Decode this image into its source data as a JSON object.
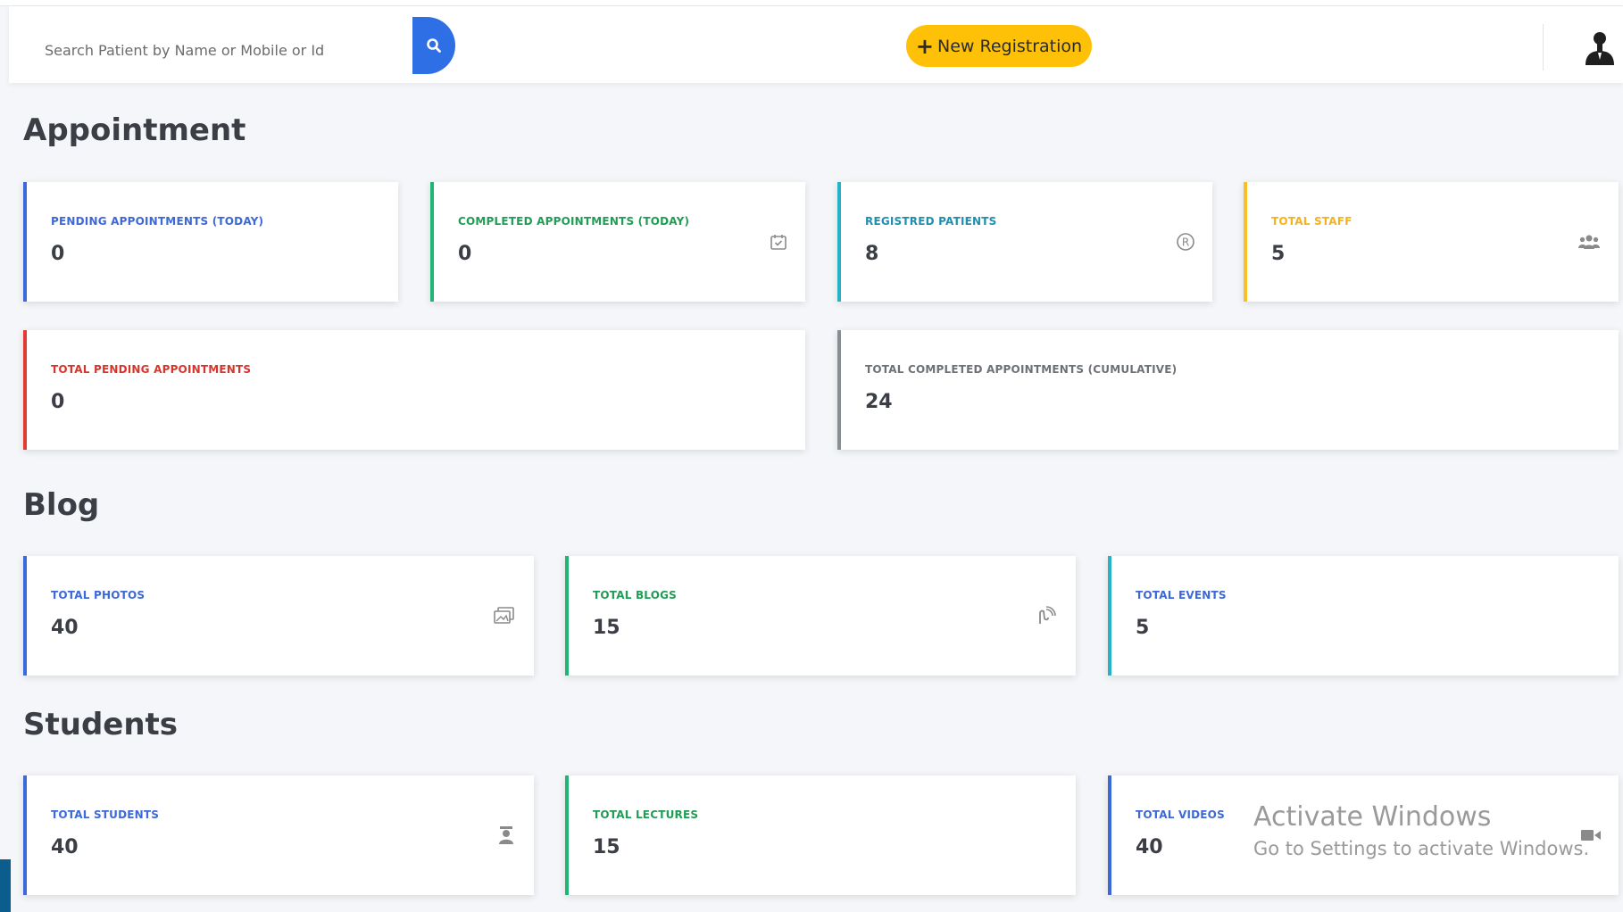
{
  "header": {
    "search_placeholder": "Search Patient by Name or Mobile or Id",
    "search_button_icon": "search-icon",
    "new_registration_label": "New Registration",
    "accent": "#2f6fe6",
    "cta_color": "#fec108",
    "user_icon": "user-icon"
  },
  "appointment": {
    "title": "Appointment",
    "pending_today": {
      "label": "PENDING APPOINTMENTS (TODAY)",
      "value": "0",
      "color": "#3d68d8"
    },
    "completed_today": {
      "label": "COMPLETED APPOINTMENTS (TODAY)",
      "value": "0",
      "color": "#21b573",
      "icon": "calendar-check-icon"
    },
    "registered_patients": {
      "label": "REGISTRED PATIENTS",
      "value": "8",
      "color": "#26b3c6",
      "icon": "registered-icon"
    },
    "total_staff": {
      "label": "TOTAL STAFF",
      "value": "5",
      "color": "#fbbf24",
      "icon": "users-icon"
    },
    "total_pending": {
      "label": "TOTAL PENDING APPOINTMENTS",
      "value": "0",
      "color": "#e23b33"
    },
    "total_completed": {
      "label": "TOTAL COMPLETED APPOINTMENTS (CUMULATIVE)",
      "value": "24",
      "color": "#888e96"
    }
  },
  "blog": {
    "title": "Blog",
    "photos": {
      "label": "TOTAL PHOTOS",
      "value": "40",
      "icon": "images-icon"
    },
    "blogs": {
      "label": "TOTAL BLOGS",
      "value": "15",
      "icon": "blog-icon"
    },
    "events": {
      "label": "TOTAL EVENTS",
      "value": "5"
    }
  },
  "students": {
    "title": "Students",
    "students": {
      "label": "TOTAL STUDENTS",
      "value": "40",
      "icon": "student-icon"
    },
    "lectures": {
      "label": "TOTAL LECTURES",
      "value": "15"
    },
    "videos": {
      "label": "TOTAL VIDEOS",
      "value": "40",
      "icon": "video-icon"
    }
  },
  "watermark": {
    "line1": "Activate Windows",
    "line2": "Go to Settings to activate Windows."
  }
}
